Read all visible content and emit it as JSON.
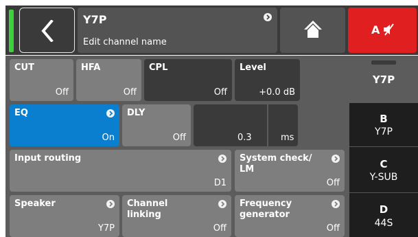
{
  "header": {
    "channel_name": "Y7P",
    "subtitle": "Edit channel name",
    "mute_label": "A"
  },
  "tiles": {
    "cut": {
      "label": "CUT",
      "value": "Off"
    },
    "hfa": {
      "label": "HFA",
      "value": "Off"
    },
    "cpl": {
      "label": "CPL",
      "value": "Off"
    },
    "level": {
      "label": "Level",
      "value": "+0.0 dB"
    },
    "eq": {
      "label": "EQ",
      "value": "On"
    },
    "dly": {
      "label": "DLY",
      "value": "Off"
    },
    "delay_value": "0.3",
    "delay_unit": "ms",
    "input_routing": {
      "label": "Input routing",
      "value": "D1"
    },
    "system_check": {
      "label_line1": "System check/",
      "label_line2": "LM",
      "value": "Off"
    },
    "speaker": {
      "label": "Speaker",
      "value": "Y7P"
    },
    "channel_linking": {
      "label_line1": "Channel",
      "label_line2": "linking",
      "value": "Off"
    },
    "frequency_generator": {
      "label_line1": "Frequency",
      "label_line2": "generator",
      "value": "Off"
    }
  },
  "channels": [
    {
      "letter": "",
      "name": "Y7P",
      "active": true
    },
    {
      "letter": "B",
      "name": "Y7P",
      "active": false
    },
    {
      "letter": "C",
      "name": "Y-SUB",
      "active": false
    },
    {
      "letter": "D",
      "name": "44S",
      "active": false
    }
  ],
  "colors": {
    "accent_blue": "#0a7fcf",
    "mute_red": "#e02020",
    "indicator_green": "#3dd13d"
  }
}
